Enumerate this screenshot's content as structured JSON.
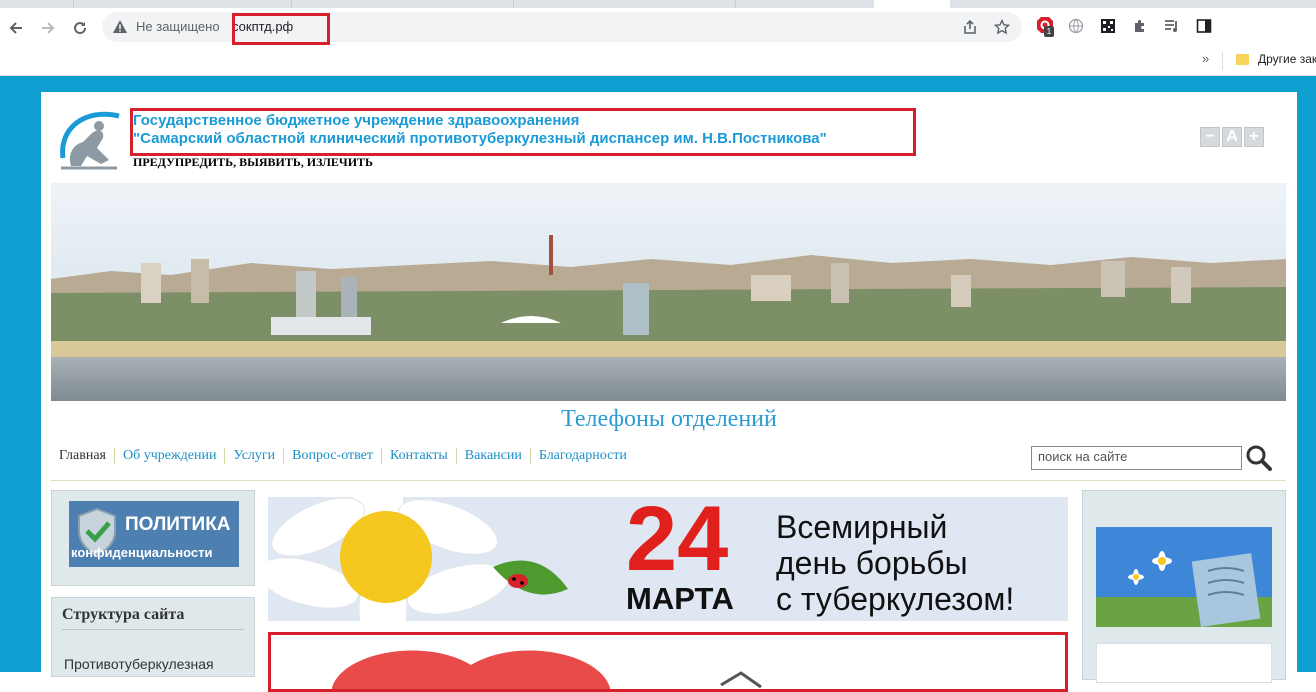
{
  "browser": {
    "security_label": "Не защищено",
    "url": "сокптд.рф",
    "bookmarks_other": "Другие зак",
    "extension_badge": "1"
  },
  "site": {
    "org_line1": "Государственное бюджетное учреждение здравоохранения",
    "org_line2": "\"Самарский областной клинический противотуберкулезный диспансер им. Н.В.Постникова\"",
    "motto": "ПРЕДУПРЕДИТЬ, ВЫЯВИТЬ, ИЗЛЕЧИТЬ",
    "font_controls": [
      "−",
      "A",
      "+"
    ],
    "phones_link": "Телефоны отделений",
    "menu": [
      "Главная",
      "Об учреждении",
      "Услуги",
      "Вопрос-ответ",
      "Контакты",
      "Вакансии",
      "Благодарности"
    ],
    "search_placeholder": "поиск на сайте"
  },
  "left": {
    "privacy_title": "ПОЛИТИКА",
    "privacy_sub": "конфиденциальности",
    "structure_heading": "Структура сайта",
    "structure_item": "Противотуберкулезная"
  },
  "banner": {
    "date_number": "24",
    "date_month": "МАРТА",
    "line1": "Всемирный",
    "line2": "день борьбы",
    "line3": "с туберкулезом!"
  },
  "colors": {
    "page_bg": "#0e9fd0",
    "accent_blue": "#1a9bd7",
    "highlight_red": "#d6202c",
    "banner_red": "#e0201c"
  }
}
